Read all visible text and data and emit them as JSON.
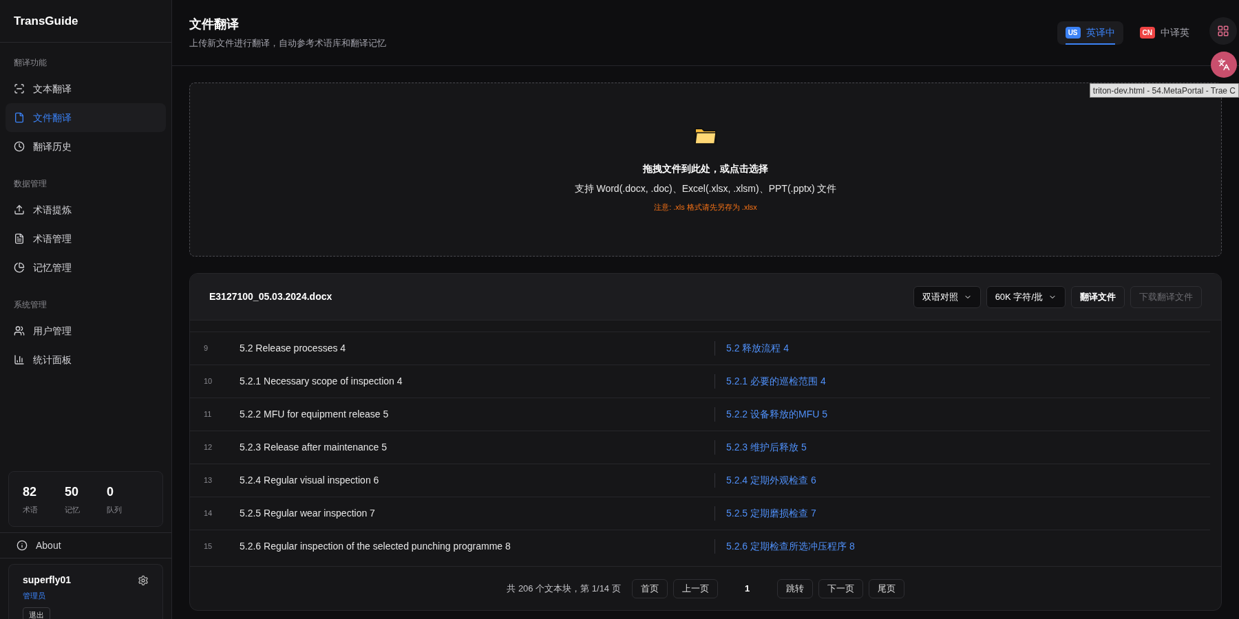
{
  "app": {
    "logo": "TransGuide"
  },
  "sidebar": {
    "sections": [
      {
        "title": "翻译功能",
        "items": [
          {
            "label": "文本翻译",
            "kind": "scan",
            "selected": false
          },
          {
            "label": "文件翻译",
            "kind": "file",
            "selected": true
          },
          {
            "label": "翻译历史",
            "kind": "clock",
            "selected": false
          }
        ]
      },
      {
        "title": "数据管理",
        "items": [
          {
            "label": "术语提炼",
            "kind": "upload",
            "selected": false
          },
          {
            "label": "术语管理",
            "kind": "filetext",
            "selected": false
          },
          {
            "label": "记忆管理",
            "kind": "pie",
            "selected": false
          }
        ]
      },
      {
        "title": "系统管理",
        "items": [
          {
            "label": "用户管理",
            "kind": "users",
            "selected": false
          },
          {
            "label": "统计面板",
            "kind": "chart",
            "selected": false
          }
        ]
      }
    ],
    "stats": [
      {
        "value": "82",
        "label": "术语"
      },
      {
        "value": "50",
        "label": "记忆"
      },
      {
        "value": "0",
        "label": "队列"
      }
    ],
    "about": "About",
    "user": {
      "name": "superfly01",
      "role": "管理员",
      "logout": "退出"
    }
  },
  "header": {
    "title": "文件翻译",
    "subtitle": "上传新文件进行翻译，自动参考术语库和翻译记忆",
    "directions": [
      {
        "flag": "US",
        "label": "英译中",
        "selected": true
      },
      {
        "flag": "CN",
        "label": "中译英",
        "selected": false
      }
    ]
  },
  "tooltip": "triton-dev.html - 54.MetaPortal - Trae C",
  "upload": {
    "title": "拖拽文件到此处，或点击选择",
    "formats": "支持 Word(.docx, .doc)、Excel(.xlsx, .xlsm)、PPT(.pptx) 文件",
    "note": "注意: .xls 格式请先另存为 .xlsx"
  },
  "file": {
    "name": "E3127100_05.03.2024.docx",
    "mode": "双语对照",
    "batch": "60K 字符/批",
    "translate": "翻译文件",
    "download": {
      "label": "下载翻译文件",
      "disabled": true
    },
    "rows": [
      {
        "index": "9",
        "source": "5.2 Release processes 4",
        "target": "5.2 释放流程 4"
      },
      {
        "index": "10",
        "source": "5.2.1 Necessary scope of inspection 4",
        "target": "5.2.1 必要的巡检范围 4"
      },
      {
        "index": "11",
        "source": "5.2.2 MFU for equipment release 5",
        "target": "5.2.2 设备释放的MFU 5"
      },
      {
        "index": "12",
        "source": "5.2.3 Release after maintenance 5",
        "target": "5.2.3 维护后释放 5"
      },
      {
        "index": "13",
        "source": "5.2.4 Regular visual inspection 6",
        "target": "5.2.4 定期外观检查 6"
      },
      {
        "index": "14",
        "source": "5.2.5 Regular wear inspection 7",
        "target": "5.2.5 定期磨损检查 7"
      },
      {
        "index": "15",
        "source": "5.2.6 Regular inspection of the selected punching programme 8",
        "target": "5.2.6 定期检查所选冲压程序 8"
      }
    ],
    "pager": {
      "summary": "共 206 个文本块，第 1/14 页",
      "first": "首页",
      "prev": "上一页",
      "page": "1",
      "go": "跳转",
      "next": "下一页",
      "last": "尾页"
    }
  }
}
